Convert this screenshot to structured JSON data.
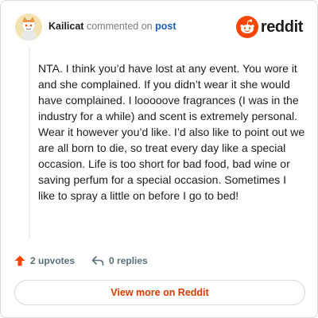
{
  "comment": {
    "username": "Kailicat",
    "action_text": "commented on",
    "post_link": "post",
    "body": "NTA. I think you’d have lost at any event. You wore it and she complained. If you didn’t wear it she would have complained. I looooove fragrances (I was in the industry for a while) and scent is extremely personal. Wear it however you’d like. I’d also like to point out we are all born to die, so treat every day like a special occasion. Life is too short for bad food, bad wine or saving perfum for a special occasion. Sometimes I like to spray a little on before I go to bed!"
  },
  "brand": {
    "name": "reddit",
    "color": "#ff4500"
  },
  "stats": {
    "upvotes": "2 upvotes",
    "replies": "0 replies"
  },
  "footer": {
    "view_more_label": "View more on Reddit"
  },
  "colors": {
    "accent": "#d93a00",
    "link": "#1a5fb4",
    "upvote": "#ff4500"
  }
}
